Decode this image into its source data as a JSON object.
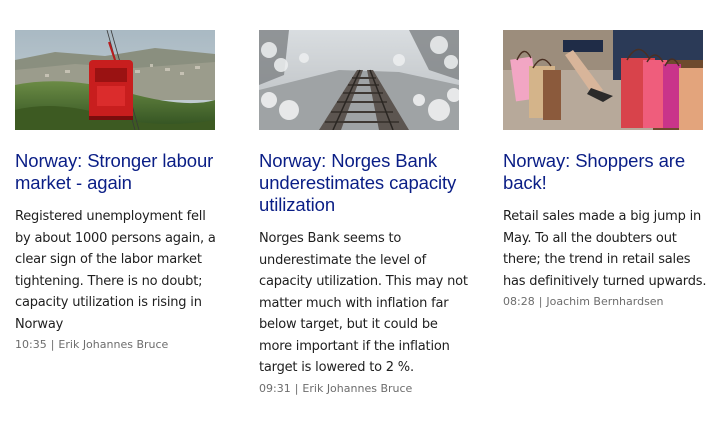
{
  "articles": [
    {
      "image": "cable-car-over-city",
      "headline": "Norway: Stronger labour market - again",
      "lead": "Registered unemployment fell by about 1000 persons again, a clear sign of the labor market tightening. There is no doubt; capacity utilization is rising in Norway",
      "time": "10:35",
      "separator": "|",
      "author": "Erik Johannes Bruce"
    },
    {
      "image": "railway-tracks-in-frost",
      "headline": "Norway: Norges Bank underestimates capacity utilization",
      "lead": "Norges Bank seems to underestimate the level of capacity utilization. This may not matter much with inflation far below target, but it could be more important if the inflation target is lowered to 2 %.",
      "time": "09:31",
      "separator": "|",
      "author": "Erik Johannes Bruce"
    },
    {
      "image": "shopping-bags",
      "headline": "Norway: Shoppers are back!",
      "lead": "Retail sales made a big jump in May. To all the doubters out there; the trend in retail sales has definitively turned upwards.",
      "time": "08:28",
      "separator": "|",
      "author": "Joachim Bernhardsen"
    }
  ],
  "colors": {
    "headline": "#0a1e86",
    "body_text": "#1e1e1e",
    "meta_text": "#6d6d6d"
  }
}
